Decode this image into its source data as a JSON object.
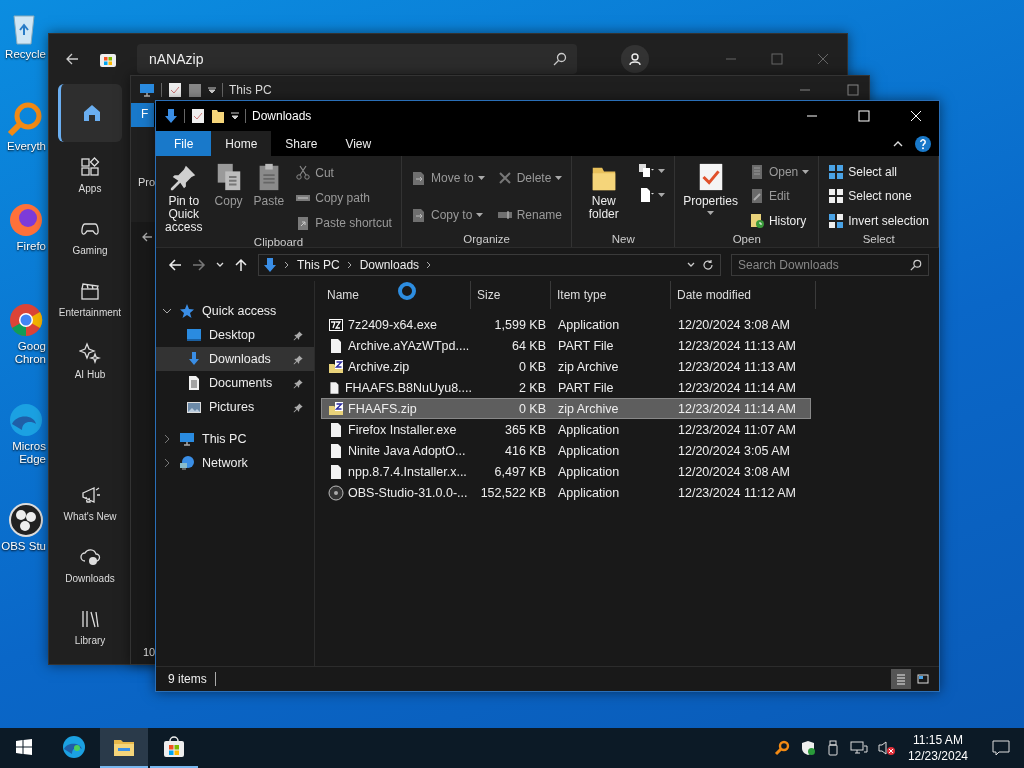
{
  "desktop_icons": [
    {
      "kind": "recycle",
      "lines": [
        "Recycle"
      ]
    },
    {
      "kind": "magnifier",
      "lines": [
        "Everyth"
      ]
    },
    {
      "kind": "firefox",
      "lines": [
        "Firefo"
      ]
    },
    {
      "kind": "chrome",
      "lines": [
        "Goog",
        "Chron"
      ]
    },
    {
      "kind": "edge",
      "lines": [
        "Micros",
        "Edge"
      ]
    },
    {
      "kind": "obs",
      "lines": [
        "OBS Stu"
      ]
    }
  ],
  "store_window": {
    "search": {
      "value": "nANAzip"
    },
    "nav": [
      {
        "kind": "home",
        "selected": true
      },
      {
        "kind": "apps",
        "label": "Apps",
        "selected": false
      },
      {
        "kind": "gaming",
        "label": "Gaming",
        "selected": false
      },
      {
        "kind": "entertainment",
        "label": "Entertainment",
        "selected": false
      },
      {
        "kind": "ai",
        "label": "AI Hub",
        "selected": false
      }
    ],
    "nav_bottom": [
      {
        "kind": "whats-new",
        "label": "What's New",
        "selected": false
      },
      {
        "kind": "downloads",
        "label": "Downloads",
        "selected": false
      },
      {
        "kind": "library",
        "label": "Library",
        "selected": false
      }
    ]
  },
  "background_explorer": {
    "title": "This PC",
    "tab": "F",
    "ribbon_text": "Pro",
    "status_text": "10"
  },
  "explorer": {
    "title": "Downloads",
    "tabs": [
      {
        "label": "File",
        "kind": "file",
        "selected": false
      },
      {
        "label": "Home",
        "kind": "tab",
        "selected": true
      },
      {
        "label": "Share",
        "kind": "tab",
        "selected": false
      },
      {
        "label": "View",
        "kind": "tab",
        "selected": false
      }
    ],
    "ribbon": [
      {
        "label": "Clipboard",
        "columns": [
          {
            "kind": "large",
            "items": [
              {
                "kind": "pin",
                "label": "Pin to Quick access",
                "disabled": false,
                "dropdown": false
              }
            ]
          },
          {
            "kind": "large",
            "items": [
              {
                "kind": "copy",
                "label": "Copy",
                "disabled": true,
                "dropdown": false
              }
            ]
          },
          {
            "kind": "large",
            "items": [
              {
                "kind": "paste",
                "label": "Paste",
                "disabled": true,
                "dropdown": false
              }
            ]
          },
          {
            "kind": "stack",
            "items": [
              {
                "kind": "cut",
                "label": "Cut",
                "disabled": true,
                "dropdown": false
              },
              {
                "kind": "copy-path",
                "label": "Copy path",
                "disabled": true,
                "dropdown": false
              },
              {
                "kind": "paste-shortcut",
                "label": "Paste shortcut",
                "disabled": true,
                "dropdown": false
              }
            ]
          }
        ]
      },
      {
        "label": "Organize",
        "columns": [
          {
            "kind": "stack",
            "items": [
              {
                "kind": "move",
                "label": "Move to",
                "disabled": true,
                "dropdown": true
              },
              {
                "kind": "copy-to",
                "label": "Copy to",
                "disabled": true,
                "dropdown": true
              }
            ]
          },
          {
            "kind": "stack",
            "items": [
              {
                "kind": "delete",
                "label": "Delete",
                "disabled": true,
                "dropdown": true
              },
              {
                "kind": "rename",
                "label": "Rename",
                "disabled": true,
                "dropdown": false
              }
            ]
          }
        ]
      },
      {
        "label": "New",
        "columns": [
          {
            "kind": "large",
            "items": [
              {
                "kind": "new-folder",
                "label": "New folder",
                "disabled": false,
                "dropdown": false
              }
            ]
          },
          {
            "kind": "icons",
            "items": [
              {
                "kind": "new-item",
                "disabled": false,
                "dropdown": true
              },
              {
                "kind": "easy-access",
                "disabled": false,
                "dropdown": true
              }
            ]
          }
        ]
      },
      {
        "label": "Open",
        "columns": [
          {
            "kind": "large",
            "items": [
              {
                "kind": "properties",
                "label": "Properties",
                "disabled": false,
                "dropdown": true
              }
            ]
          },
          {
            "kind": "stack",
            "items": [
              {
                "kind": "open",
                "label": "Open",
                "disabled": true,
                "dropdown": true
              },
              {
                "kind": "edit",
                "label": "Edit",
                "disabled": true,
                "dropdown": false
              },
              {
                "kind": "history",
                "label": "History",
                "disabled": false,
                "dropdown": false
              }
            ]
          }
        ]
      },
      {
        "label": "Select",
        "columns": [
          {
            "kind": "stack",
            "items": [
              {
                "kind": "select-all",
                "label": "Select all",
                "disabled": false,
                "dropdown": false
              },
              {
                "kind": "select-none",
                "label": "Select none",
                "disabled": false,
                "dropdown": false
              },
              {
                "kind": "invert",
                "label": "Invert selection",
                "disabled": false,
                "dropdown": false
              }
            ]
          }
        ]
      }
    ],
    "breadcrumb": [
      "This PC",
      "Downloads"
    ],
    "search": {
      "placeholder": "Search Downloads"
    },
    "nav": [
      {
        "kind": "star",
        "label": "Quick access",
        "expanded": true,
        "selected": false,
        "children": [
          {
            "kind": "desktop",
            "label": "Desktop",
            "pinned": true,
            "selected": false
          },
          {
            "kind": "download",
            "label": "Downloads",
            "pinned": true,
            "selected": true
          },
          {
            "kind": "document",
            "label": "Documents",
            "pinned": true,
            "selected": false
          },
          {
            "kind": "picture",
            "label": "Pictures",
            "pinned": true,
            "selected": false
          }
        ]
      },
      {
        "kind": "pc",
        "label": "This PC",
        "expanded": false,
        "selected": false
      },
      {
        "kind": "network",
        "label": "Network",
        "expanded": false,
        "selected": false
      }
    ],
    "columns": [
      "Name",
      "Size",
      "Item type",
      "Date modified"
    ],
    "rows": [
      {
        "kind": "sevenzip",
        "name": "7z2409-x64.exe",
        "size": "1,599 KB",
        "type": "Application",
        "date": "12/20/2024 3:08 AM",
        "selected": false
      },
      {
        "kind": "file",
        "name": "Archive.aYAzWTpd....",
        "size": "64 KB",
        "type": "PART File",
        "date": "12/23/2024 11:13 AM",
        "selected": false
      },
      {
        "kind": "zip",
        "name": "Archive.zip",
        "size": "0 KB",
        "type": "zip Archive",
        "date": "12/23/2024 11:13 AM",
        "selected": false
      },
      {
        "kind": "file",
        "name": "FHAAFS.B8NuUyu8....",
        "size": "2 KB",
        "type": "PART File",
        "date": "12/23/2024 11:14 AM",
        "selected": false
      },
      {
        "kind": "zip",
        "name": "FHAAFS.zip",
        "size": "0 KB",
        "type": "zip Archive",
        "date": "12/23/2024 11:14 AM",
        "selected": true
      },
      {
        "kind": "file",
        "name": "Firefox Installer.exe",
        "size": "365 KB",
        "type": "Application",
        "date": "12/23/2024 11:07 AM",
        "selected": false
      },
      {
        "kind": "file",
        "name": "Ninite Java AdoptO...",
        "size": "416 KB",
        "type": "Application",
        "date": "12/20/2024 3:05 AM",
        "selected": false
      },
      {
        "kind": "file",
        "name": "npp.8.7.4.Installer.x...",
        "size": "6,497 KB",
        "type": "Application",
        "date": "12/20/2024 3:08 AM",
        "selected": false
      },
      {
        "kind": "disc",
        "name": "OBS-Studio-31.0.0-...",
        "size": "152,522 KB",
        "type": "Application",
        "date": "12/23/2024 11:12 AM",
        "selected": false
      }
    ],
    "status": "9 items",
    "views": [
      {
        "kind": "details",
        "selected": true
      },
      {
        "kind": "tiles",
        "selected": false
      }
    ]
  },
  "taskbar": {
    "apps": [
      {
        "kind": "edge",
        "open": false,
        "selected": false
      },
      {
        "kind": "explorer",
        "open": true,
        "selected": true
      },
      {
        "kind": "store",
        "open": true,
        "selected": false
      }
    ],
    "time": "11:15 AM",
    "date": "12/23/2024"
  }
}
